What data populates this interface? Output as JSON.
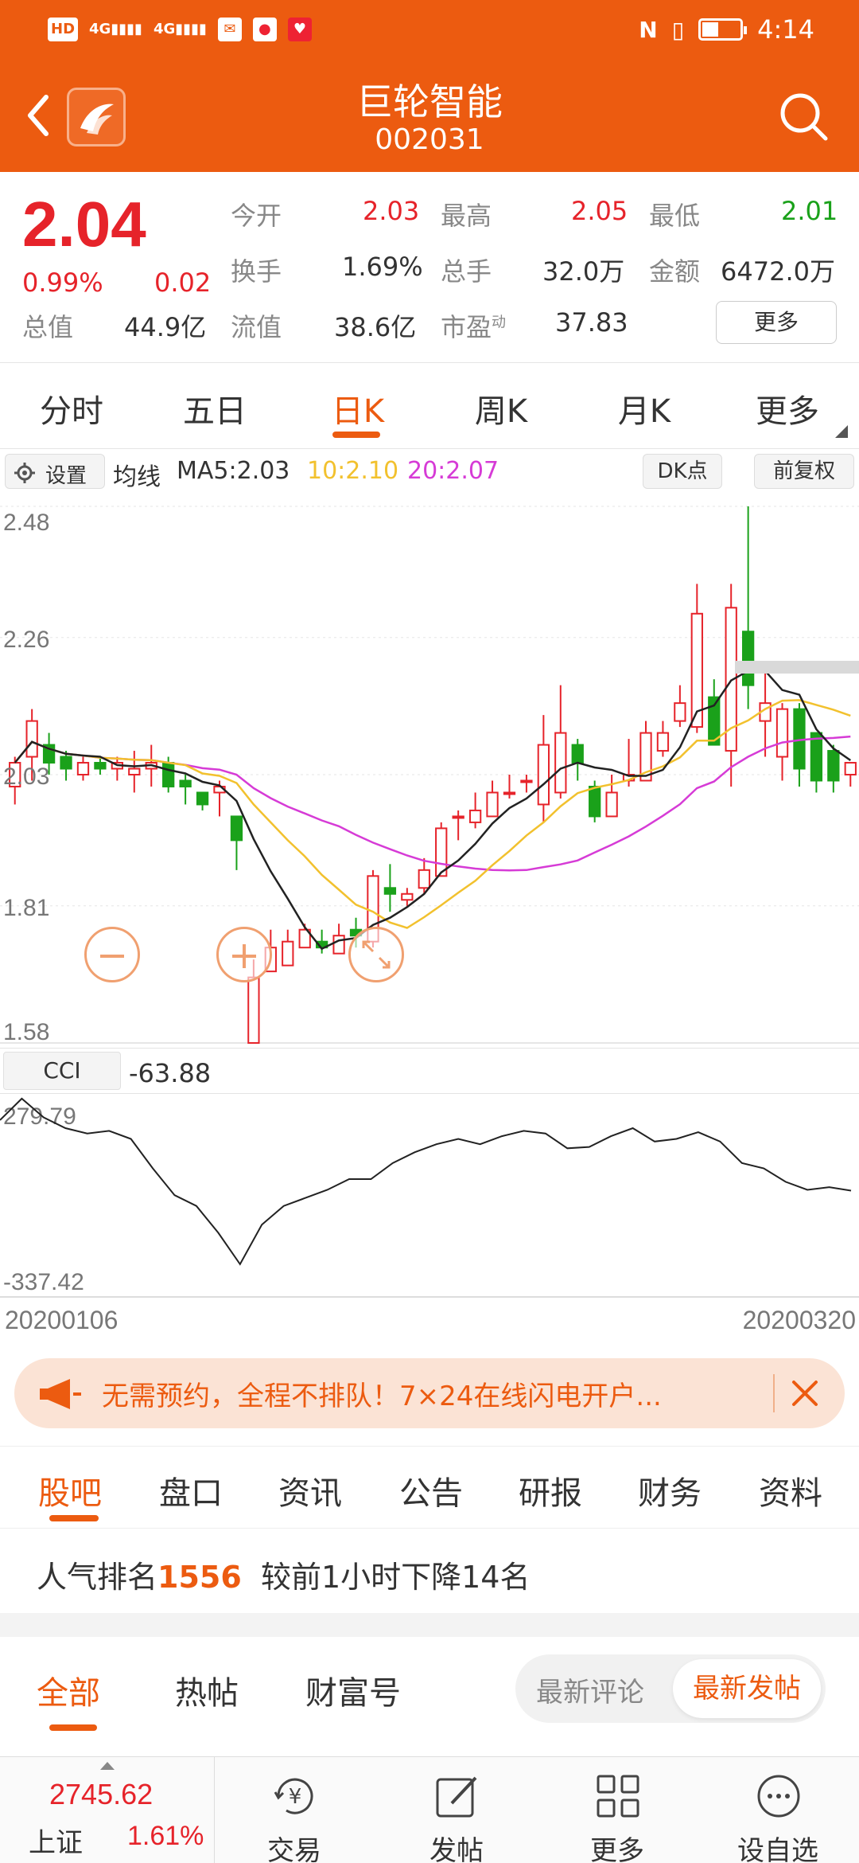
{
  "status_bar": {
    "time": "4:14",
    "left_text": "HD",
    "signal1": "4G",
    "signal2": "4G"
  },
  "header": {
    "title": "巨轮智能",
    "code": "002031"
  },
  "quote": {
    "price": "2.04",
    "change_pct": "0.99%",
    "change": "0.02",
    "row1": [
      {
        "label": "今开",
        "value": "2.03"
      },
      {
        "label": "最高",
        "value": "2.05"
      },
      {
        "label": "最低",
        "value": "2.01"
      }
    ],
    "row2": [
      {
        "label": "换手",
        "value": "1.69%"
      },
      {
        "label": "总手",
        "value": "32.0万"
      },
      {
        "label": "金额",
        "value": "6472.0万"
      }
    ],
    "row3": [
      {
        "label": "总值",
        "value": "44.9亿"
      },
      {
        "label": "流值",
        "value": "38.6亿"
      },
      {
        "label": "市盈",
        "sup": "动",
        "value": "37.83"
      }
    ],
    "more_label": "更多"
  },
  "tabs": [
    "分时",
    "五日",
    "日K",
    "周K",
    "月K",
    "更多"
  ],
  "ma_bar": {
    "settings_label": "设置",
    "ma_label": "均线",
    "ma5": "MA5:2.03",
    "ma10": "10:2.10",
    "ma20": "20:2.07",
    "dk_label": "DK点",
    "adjust_label": "前复权"
  },
  "colors": {
    "brand": "#ec5b10",
    "up": "#e6232a",
    "down": "#1aa11a",
    "ma5": "#222222",
    "ma10": "#f2c12e",
    "ma20": "#d63bd6"
  },
  "chart_data": {
    "type": "candlestick",
    "y_ticks": [
      "2.48",
      "2.26",
      "2.03",
      "1.81",
      "1.58"
    ],
    "ylim": [
      1.58,
      2.48
    ],
    "x_start": "20200106",
    "x_end": "20200320",
    "candles": [
      [
        2.01,
        2.05,
        1.98,
        2.06
      ],
      [
        2.06,
        2.12,
        2.02,
        2.14
      ],
      [
        2.08,
        2.05,
        2.03,
        2.1
      ],
      [
        2.06,
        2.04,
        2.02,
        2.07
      ],
      [
        2.03,
        2.05,
        2.02,
        2.06
      ],
      [
        2.05,
        2.04,
        2.03,
        2.06
      ],
      [
        2.04,
        2.05,
        2.02,
        2.06
      ],
      [
        2.03,
        2.04,
        2.0,
        2.07
      ],
      [
        2.04,
        2.05,
        2.01,
        2.08
      ],
      [
        2.05,
        2.01,
        2.0,
        2.06
      ],
      [
        2.02,
        2.01,
        1.98,
        2.03
      ],
      [
        2.0,
        1.98,
        1.97,
        2.0
      ],
      [
        2.0,
        2.01,
        1.96,
        2.02
      ],
      [
        1.96,
        1.92,
        1.87,
        1.96
      ],
      [
        1.58,
        1.69,
        1.58,
        1.72
      ],
      [
        1.7,
        1.74,
        1.7,
        1.77
      ],
      [
        1.71,
        1.75,
        1.71,
        1.77
      ],
      [
        1.74,
        1.77,
        1.74,
        1.78
      ],
      [
        1.75,
        1.74,
        1.73,
        1.77
      ],
      [
        1.73,
        1.76,
        1.73,
        1.78
      ],
      [
        1.77,
        1.76,
        1.74,
        1.79
      ],
      [
        1.75,
        1.86,
        1.74,
        1.87
      ],
      [
        1.84,
        1.83,
        1.8,
        1.88
      ],
      [
        1.82,
        1.83,
        1.81,
        1.84
      ],
      [
        1.84,
        1.87,
        1.83,
        1.89
      ],
      [
        1.86,
        1.94,
        1.86,
        1.95
      ],
      [
        1.96,
        1.96,
        1.92,
        1.97
      ],
      [
        1.95,
        1.97,
        1.94,
        2.0
      ],
      [
        1.96,
        2.0,
        1.96,
        2.02
      ],
      [
        2.0,
        2.0,
        1.99,
        2.03
      ],
      [
        2.02,
        2.02,
        2.0,
        2.03
      ],
      [
        1.98,
        2.08,
        1.95,
        2.13
      ],
      [
        2.0,
        2.1,
        1.99,
        2.18
      ],
      [
        2.08,
        2.05,
        2.02,
        2.09
      ],
      [
        2.01,
        1.96,
        1.95,
        2.02
      ],
      [
        1.96,
        2.0,
        1.96,
        2.03
      ],
      [
        2.02,
        2.03,
        2.01,
        2.09
      ],
      [
        2.02,
        2.1,
        2.02,
        2.12
      ],
      [
        2.07,
        2.1,
        2.06,
        2.12
      ],
      [
        2.12,
        2.15,
        2.11,
        2.18
      ],
      [
        2.11,
        2.3,
        2.1,
        2.35
      ],
      [
        2.16,
        2.08,
        2.14,
        2.19
      ],
      [
        2.07,
        2.31,
        2.01,
        2.35
      ],
      [
        2.27,
        2.18,
        2.14,
        2.48
      ],
      [
        2.12,
        2.15,
        2.06,
        2.21
      ],
      [
        2.06,
        2.14,
        2.02,
        2.15
      ],
      [
        2.14,
        2.04,
        2.01,
        2.15
      ],
      [
        2.1,
        2.02,
        2.0,
        2.08
      ],
      [
        2.07,
        2.02,
        2.0,
        2.08
      ],
      [
        2.03,
        2.05,
        2.01,
        2.05
      ]
    ],
    "ma_note": "MA5 black, MA10 yellow, MA20 magenta"
  },
  "chart_controls": {
    "zoom_out": "−",
    "zoom_in": "+"
  },
  "cci": {
    "label": "CCI",
    "value": "-63.88",
    "max": "279.79",
    "min": "-337.42",
    "values": [
      200,
      280,
      210,
      170,
      150,
      160,
      130,
      20,
      -80,
      -120,
      -220,
      -337,
      -190,
      -120,
      -90,
      -60,
      -20,
      -20,
      40,
      80,
      110,
      130,
      110,
      140,
      160,
      150,
      95,
      100,
      140,
      170,
      120,
      130,
      155,
      120,
      40,
      20,
      -30,
      -60,
      -50,
      -63
    ]
  },
  "banner": {
    "text": "无需预约，全程不排队！7×24在线闪电开户..."
  },
  "section_tabs": [
    "股吧",
    "盘口",
    "资讯",
    "公告",
    "研报",
    "财务",
    "资料"
  ],
  "rank": {
    "prefix": "人气排名",
    "rank": "1556",
    "suffix": "较前1小时下降14名"
  },
  "filter_tabs": [
    "全部",
    "热帖",
    "财富号"
  ],
  "segment": {
    "option1": "最新评论",
    "option2": "最新发帖"
  },
  "bottom_bar": {
    "index_value": "2745.62",
    "index_name": "上证",
    "index_change": "1.61%",
    "items": [
      "交易",
      "发帖",
      "更多",
      "设自选"
    ]
  }
}
